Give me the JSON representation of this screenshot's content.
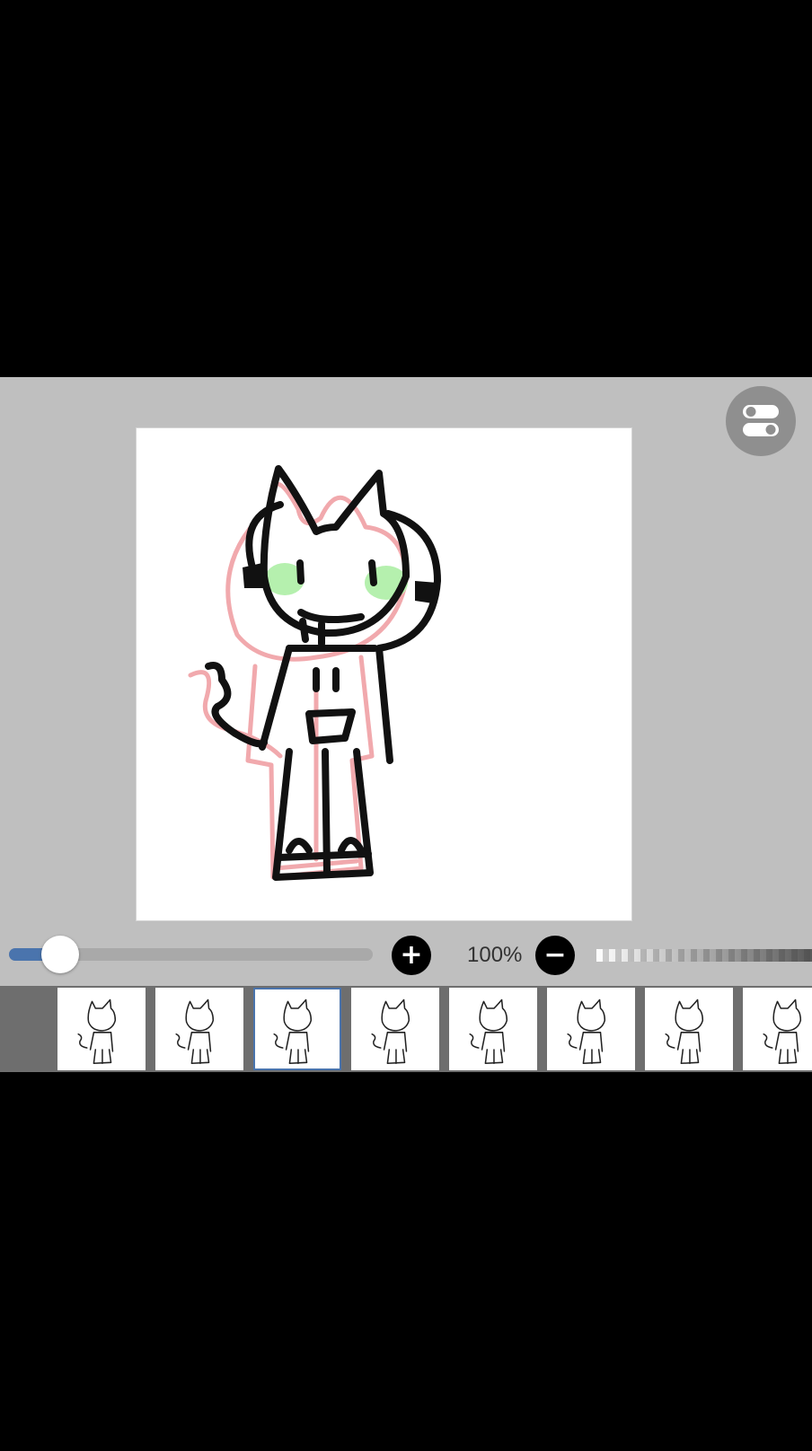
{
  "app": {
    "zoom_label": "100%",
    "brush_size_fraction": 0.14,
    "accent_color": "#4a74ad"
  },
  "icons": {
    "toggle": "settings-toggle-icon",
    "plus": "plus-icon",
    "minus": "minus-icon"
  },
  "filmstrip": {
    "frame_count": 8,
    "selected_index": 2
  }
}
